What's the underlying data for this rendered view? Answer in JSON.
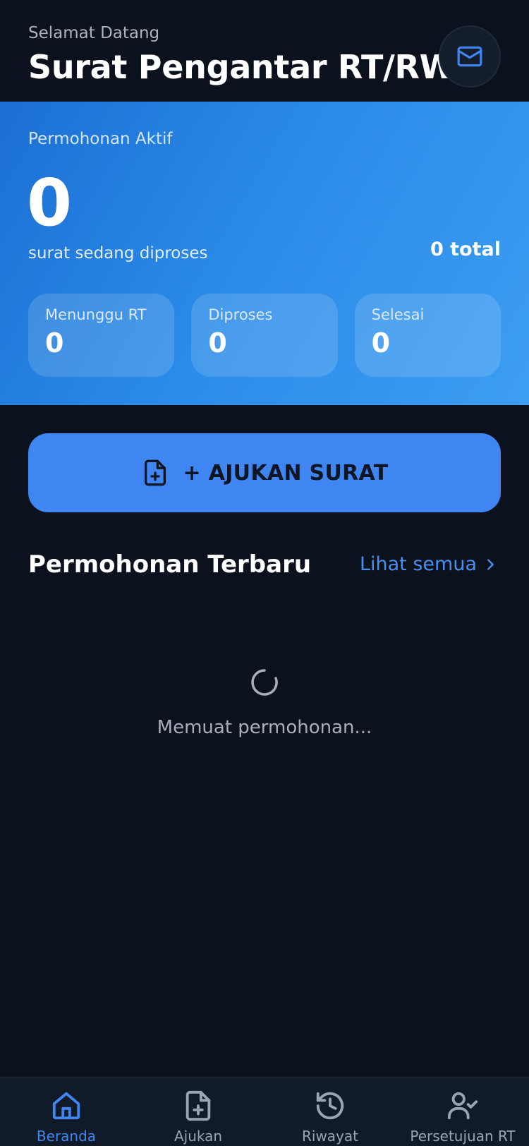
{
  "header": {
    "greeting": "Selamat Datang",
    "title": "Surat Pengantar RT/RW",
    "mail_icon": "mail-icon"
  },
  "hero": {
    "label": "Permohonan Aktif",
    "count": "0",
    "subtitle": "surat sedang diproses",
    "total": "0 total",
    "stats": [
      {
        "label": "Menunggu RT",
        "value": "0"
      },
      {
        "label": "Diproses",
        "value": "0"
      },
      {
        "label": "Selesai",
        "value": "0"
      }
    ]
  },
  "action": {
    "label": "+ AJUKAN SURAT",
    "icon": "file-plus-icon"
  },
  "recent": {
    "title": "Permohonan Terbaru",
    "see_all": "Lihat semua",
    "loading_text": "Memuat permohonan..."
  },
  "nav": {
    "items": [
      {
        "label": "Beranda",
        "icon": "home-icon",
        "active": true
      },
      {
        "label": "Ajukan",
        "icon": "file-plus-icon",
        "active": false
      },
      {
        "label": "Riwayat",
        "icon": "history-icon",
        "active": false
      },
      {
        "label": "Persetujuan RT",
        "icon": "user-check-icon",
        "active": false
      }
    ]
  },
  "colors": {
    "background": "#0b111d",
    "accent": "#3f86f2",
    "hero_start": "#1c6fd3",
    "hero_end": "#3d9ef2",
    "muted_text": "#a6afbe"
  }
}
